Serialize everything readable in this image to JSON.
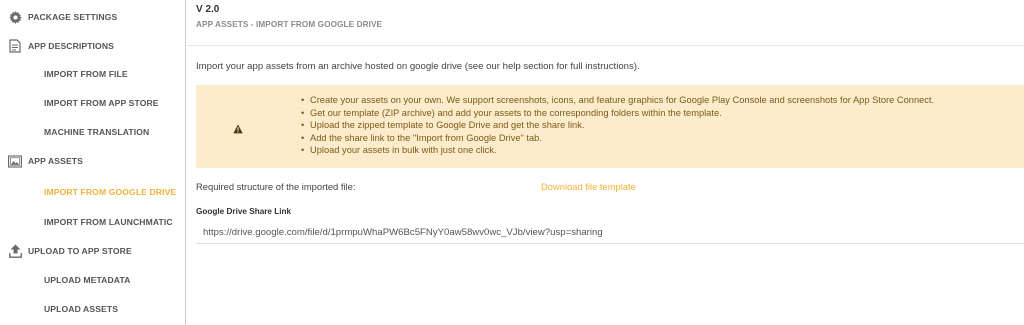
{
  "sidebar": {
    "items": [
      {
        "label": "PACKAGE SETTINGS",
        "icon": "gear-icon"
      },
      {
        "label": "APP DESCRIPTIONS",
        "icon": "document-icon"
      },
      {
        "label": "IMPORT FROM FILE"
      },
      {
        "label": "IMPORT FROM APP STORE"
      },
      {
        "label": "MACHINE TRANSLATION"
      },
      {
        "label": "APP ASSETS",
        "icon": "image-icon"
      },
      {
        "label": "IMPORT FROM GOOGLE DRIVE",
        "active": true
      },
      {
        "label": "IMPORT FROM LAUNCHMATIC"
      },
      {
        "label": "UPLOAD TO APP STORE",
        "icon": "upload-icon"
      },
      {
        "label": "UPLOAD METADATA"
      },
      {
        "label": "UPLOAD ASSETS"
      }
    ]
  },
  "main": {
    "version": "V 2.0",
    "section_title": "APP ASSETS - IMPORT FROM GOOGLE DRIVE",
    "intro": "Import your app assets from an archive hosted on google drive (see our help section for full instructions).",
    "warning": {
      "icon": "warning-icon",
      "items": [
        "Create your assets on your own. We support screenshots, icons, and feature graphics for Google Play Console and screenshots for App Store Connect.",
        "Get our template (ZIP archive) and add your assets to the corresponding folders within the template.",
        "Upload the zipped template to Google Drive and get the share link.",
        "Add the share link to the \"Import from Google Drive\" tab.",
        "Upload your assets in bulk with just one click."
      ]
    },
    "required_label": "Required structure of the imported file:",
    "download_link": "Download file template",
    "gdrive_label": "Google Drive Share Link",
    "gdrive_value": "https://drive.google.com/file/d/1prmpuWhaPW6Bc5FNyY0aw58wv0wc_VJb/view?usp=sharing"
  },
  "colors": {
    "accent": "#f0b23a",
    "warning_bg": "#fdeccb",
    "warning_text": "#7a5a1a"
  }
}
